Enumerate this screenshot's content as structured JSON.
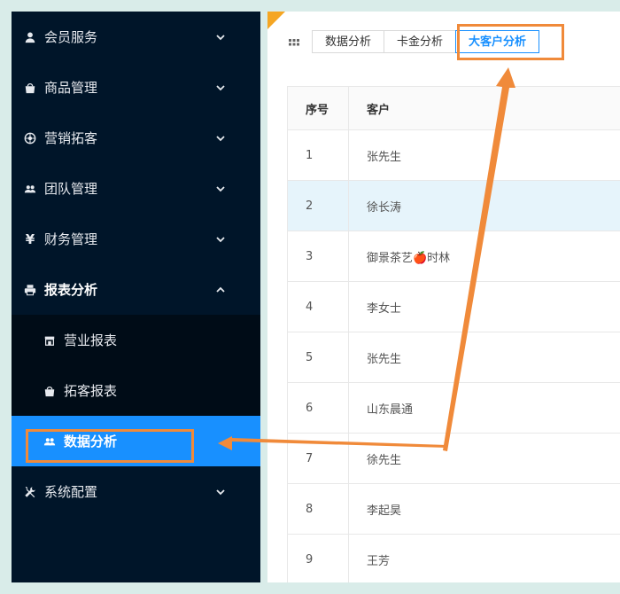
{
  "sidebar": {
    "items": [
      {
        "label": "会员服务",
        "icon": "user-icon"
      },
      {
        "label": "商品管理",
        "icon": "bag-icon"
      },
      {
        "label": "营销拓客",
        "icon": "aperture-icon"
      },
      {
        "label": "团队管理",
        "icon": "team-icon"
      },
      {
        "label": "财务管理",
        "icon": "yen-icon"
      },
      {
        "label": "报表分析",
        "icon": "printer-icon"
      }
    ],
    "sub_items": [
      {
        "label": "营业报表",
        "icon": "shop-icon"
      },
      {
        "label": "拓客报表",
        "icon": "bag-icon"
      },
      {
        "label": "数据分析",
        "icon": "team-icon"
      }
    ],
    "bottom_item": {
      "label": "系统配置",
      "icon": "tools-icon"
    }
  },
  "tabs": [
    {
      "label": "数据分析"
    },
    {
      "label": "卡金分析"
    },
    {
      "label": "大客户分析"
    }
  ],
  "table": {
    "headers": {
      "index": "序号",
      "customer": "客户"
    },
    "rows": [
      {
        "index": "1",
        "customer": "张先生"
      },
      {
        "index": "2",
        "customer": "徐长涛"
      },
      {
        "index": "3",
        "customer": "御景茶艺🍎时林"
      },
      {
        "index": "4",
        "customer": "李女士"
      },
      {
        "index": "5",
        "customer": "张先生"
      },
      {
        "index": "6",
        "customer": "山东晨通"
      },
      {
        "index": "7",
        "customer": "徐先生"
      },
      {
        "index": "8",
        "customer": "李起昊"
      },
      {
        "index": "9",
        "customer": "王芳"
      }
    ]
  },
  "colors": {
    "sidebar_bg": "#001529",
    "active_blue": "#1890ff",
    "annotation_orange": "#f08a3a"
  }
}
